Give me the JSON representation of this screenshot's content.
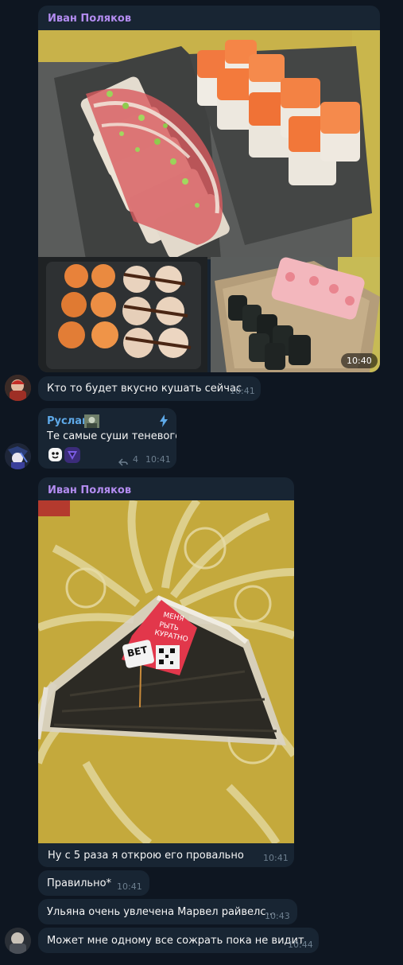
{
  "messages": [
    {
      "sender": "Иван Поляков",
      "time": "10:40",
      "media": [
        "sushi-rolls-photo",
        "fried-rolls-photo",
        "maki-rolls-photo"
      ]
    },
    {
      "text": "Кто то будет вкусно кушать сейчас",
      "time": "10:41"
    },
    {
      "sender": "Руслан",
      "text": "Те самые суши теневого",
      "reply_count": "4",
      "time": "10:41"
    },
    {
      "sender": "Иван Поляков",
      "sticker_label": "ВЕТ",
      "sticker_text_1": "МЕНЯ",
      "sticker_text_2": "РЫТЬ",
      "sticker_text_3": "КУРАТНО",
      "text": "Ну с 5 раза я открою его провально",
      "time": "10:41"
    },
    {
      "text": "Правильно*",
      "time": "10:41"
    },
    {
      "text": "Ульяна очень увлечена Марвел райвелс…",
      "time": "10:43"
    },
    {
      "text": "Может мне одному все сожрать пока не видит",
      "time": "10:44"
    }
  ],
  "colors": {
    "background": "#0e1621",
    "bubble": "#182533",
    "sender_ivan": "#b38cf0",
    "sender_ruslan": "#5ea9e8",
    "time": "#6d7f8f"
  }
}
